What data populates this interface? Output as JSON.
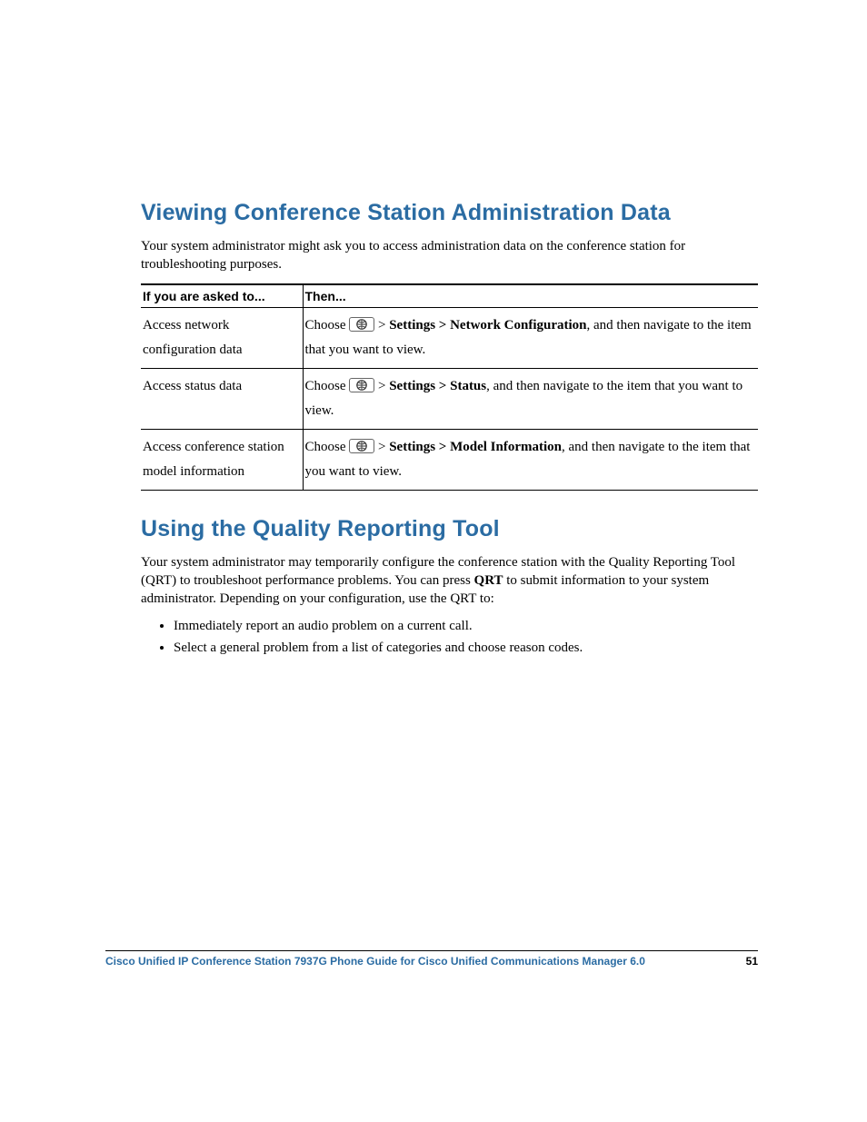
{
  "section1": {
    "heading": "Viewing Conference Station Administration Data",
    "intro": "Your system administrator might ask you to access administration data on the conference station for troubleshooting purposes."
  },
  "table": {
    "headers": [
      "If you are asked to...",
      "Then..."
    ],
    "rows": [
      {
        "left": "Access network configuration data",
        "choose": "Choose ",
        "path0": " > ",
        "path1": "Settings > Network Configuration",
        "tail": ", and then navigate to the item that you want to view."
      },
      {
        "left": "Access status data",
        "choose": "Choose ",
        "path0": " > ",
        "path1": "Settings > Status",
        "tail": ", and then navigate to the item that you want to view."
      },
      {
        "left": "Access conference station model information",
        "choose": "Choose ",
        "path0": " > ",
        "path1": "Settings > Model Information",
        "tail": ", and then navigate to the item that you want to view."
      }
    ]
  },
  "section2": {
    "heading": "Using the Quality Reporting Tool",
    "p1a": "Your system administrator may temporarily configure the conference station with the Quality Reporting Tool (QRT) to troubleshoot performance problems. You can press ",
    "p1b": "QRT",
    "p1c": " to submit information to your system administrator. Depending on your configuration, use the QRT to:",
    "bullets": [
      "Immediately report an audio problem on a current call.",
      "Select a general problem from a list of categories and choose reason codes."
    ]
  },
  "footer": {
    "title": "Cisco Unified IP Conference Station 7937G Phone Guide for Cisco Unified Communications Manager 6.0",
    "page": "51"
  }
}
